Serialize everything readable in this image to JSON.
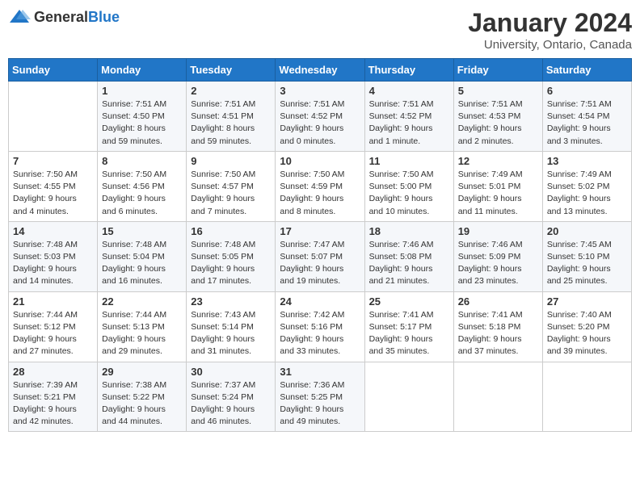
{
  "logo": {
    "text_general": "General",
    "text_blue": "Blue"
  },
  "title": "January 2024",
  "subtitle": "University, Ontario, Canada",
  "days_of_week": [
    "Sunday",
    "Monday",
    "Tuesday",
    "Wednesday",
    "Thursday",
    "Friday",
    "Saturday"
  ],
  "weeks": [
    [
      {
        "num": "",
        "info": ""
      },
      {
        "num": "1",
        "info": "Sunrise: 7:51 AM\nSunset: 4:50 PM\nDaylight: 8 hours\nand 59 minutes."
      },
      {
        "num": "2",
        "info": "Sunrise: 7:51 AM\nSunset: 4:51 PM\nDaylight: 8 hours\nand 59 minutes."
      },
      {
        "num": "3",
        "info": "Sunrise: 7:51 AM\nSunset: 4:52 PM\nDaylight: 9 hours\nand 0 minutes."
      },
      {
        "num": "4",
        "info": "Sunrise: 7:51 AM\nSunset: 4:52 PM\nDaylight: 9 hours\nand 1 minute."
      },
      {
        "num": "5",
        "info": "Sunrise: 7:51 AM\nSunset: 4:53 PM\nDaylight: 9 hours\nand 2 minutes."
      },
      {
        "num": "6",
        "info": "Sunrise: 7:51 AM\nSunset: 4:54 PM\nDaylight: 9 hours\nand 3 minutes."
      }
    ],
    [
      {
        "num": "7",
        "info": "Sunrise: 7:50 AM\nSunset: 4:55 PM\nDaylight: 9 hours\nand 4 minutes."
      },
      {
        "num": "8",
        "info": "Sunrise: 7:50 AM\nSunset: 4:56 PM\nDaylight: 9 hours\nand 6 minutes."
      },
      {
        "num": "9",
        "info": "Sunrise: 7:50 AM\nSunset: 4:57 PM\nDaylight: 9 hours\nand 7 minutes."
      },
      {
        "num": "10",
        "info": "Sunrise: 7:50 AM\nSunset: 4:59 PM\nDaylight: 9 hours\nand 8 minutes."
      },
      {
        "num": "11",
        "info": "Sunrise: 7:50 AM\nSunset: 5:00 PM\nDaylight: 9 hours\nand 10 minutes."
      },
      {
        "num": "12",
        "info": "Sunrise: 7:49 AM\nSunset: 5:01 PM\nDaylight: 9 hours\nand 11 minutes."
      },
      {
        "num": "13",
        "info": "Sunrise: 7:49 AM\nSunset: 5:02 PM\nDaylight: 9 hours\nand 13 minutes."
      }
    ],
    [
      {
        "num": "14",
        "info": "Sunrise: 7:48 AM\nSunset: 5:03 PM\nDaylight: 9 hours\nand 14 minutes."
      },
      {
        "num": "15",
        "info": "Sunrise: 7:48 AM\nSunset: 5:04 PM\nDaylight: 9 hours\nand 16 minutes."
      },
      {
        "num": "16",
        "info": "Sunrise: 7:48 AM\nSunset: 5:05 PM\nDaylight: 9 hours\nand 17 minutes."
      },
      {
        "num": "17",
        "info": "Sunrise: 7:47 AM\nSunset: 5:07 PM\nDaylight: 9 hours\nand 19 minutes."
      },
      {
        "num": "18",
        "info": "Sunrise: 7:46 AM\nSunset: 5:08 PM\nDaylight: 9 hours\nand 21 minutes."
      },
      {
        "num": "19",
        "info": "Sunrise: 7:46 AM\nSunset: 5:09 PM\nDaylight: 9 hours\nand 23 minutes."
      },
      {
        "num": "20",
        "info": "Sunrise: 7:45 AM\nSunset: 5:10 PM\nDaylight: 9 hours\nand 25 minutes."
      }
    ],
    [
      {
        "num": "21",
        "info": "Sunrise: 7:44 AM\nSunset: 5:12 PM\nDaylight: 9 hours\nand 27 minutes."
      },
      {
        "num": "22",
        "info": "Sunrise: 7:44 AM\nSunset: 5:13 PM\nDaylight: 9 hours\nand 29 minutes."
      },
      {
        "num": "23",
        "info": "Sunrise: 7:43 AM\nSunset: 5:14 PM\nDaylight: 9 hours\nand 31 minutes."
      },
      {
        "num": "24",
        "info": "Sunrise: 7:42 AM\nSunset: 5:16 PM\nDaylight: 9 hours\nand 33 minutes."
      },
      {
        "num": "25",
        "info": "Sunrise: 7:41 AM\nSunset: 5:17 PM\nDaylight: 9 hours\nand 35 minutes."
      },
      {
        "num": "26",
        "info": "Sunrise: 7:41 AM\nSunset: 5:18 PM\nDaylight: 9 hours\nand 37 minutes."
      },
      {
        "num": "27",
        "info": "Sunrise: 7:40 AM\nSunset: 5:20 PM\nDaylight: 9 hours\nand 39 minutes."
      }
    ],
    [
      {
        "num": "28",
        "info": "Sunrise: 7:39 AM\nSunset: 5:21 PM\nDaylight: 9 hours\nand 42 minutes."
      },
      {
        "num": "29",
        "info": "Sunrise: 7:38 AM\nSunset: 5:22 PM\nDaylight: 9 hours\nand 44 minutes."
      },
      {
        "num": "30",
        "info": "Sunrise: 7:37 AM\nSunset: 5:24 PM\nDaylight: 9 hours\nand 46 minutes."
      },
      {
        "num": "31",
        "info": "Sunrise: 7:36 AM\nSunset: 5:25 PM\nDaylight: 9 hours\nand 49 minutes."
      },
      {
        "num": "",
        "info": ""
      },
      {
        "num": "",
        "info": ""
      },
      {
        "num": "",
        "info": ""
      }
    ]
  ]
}
